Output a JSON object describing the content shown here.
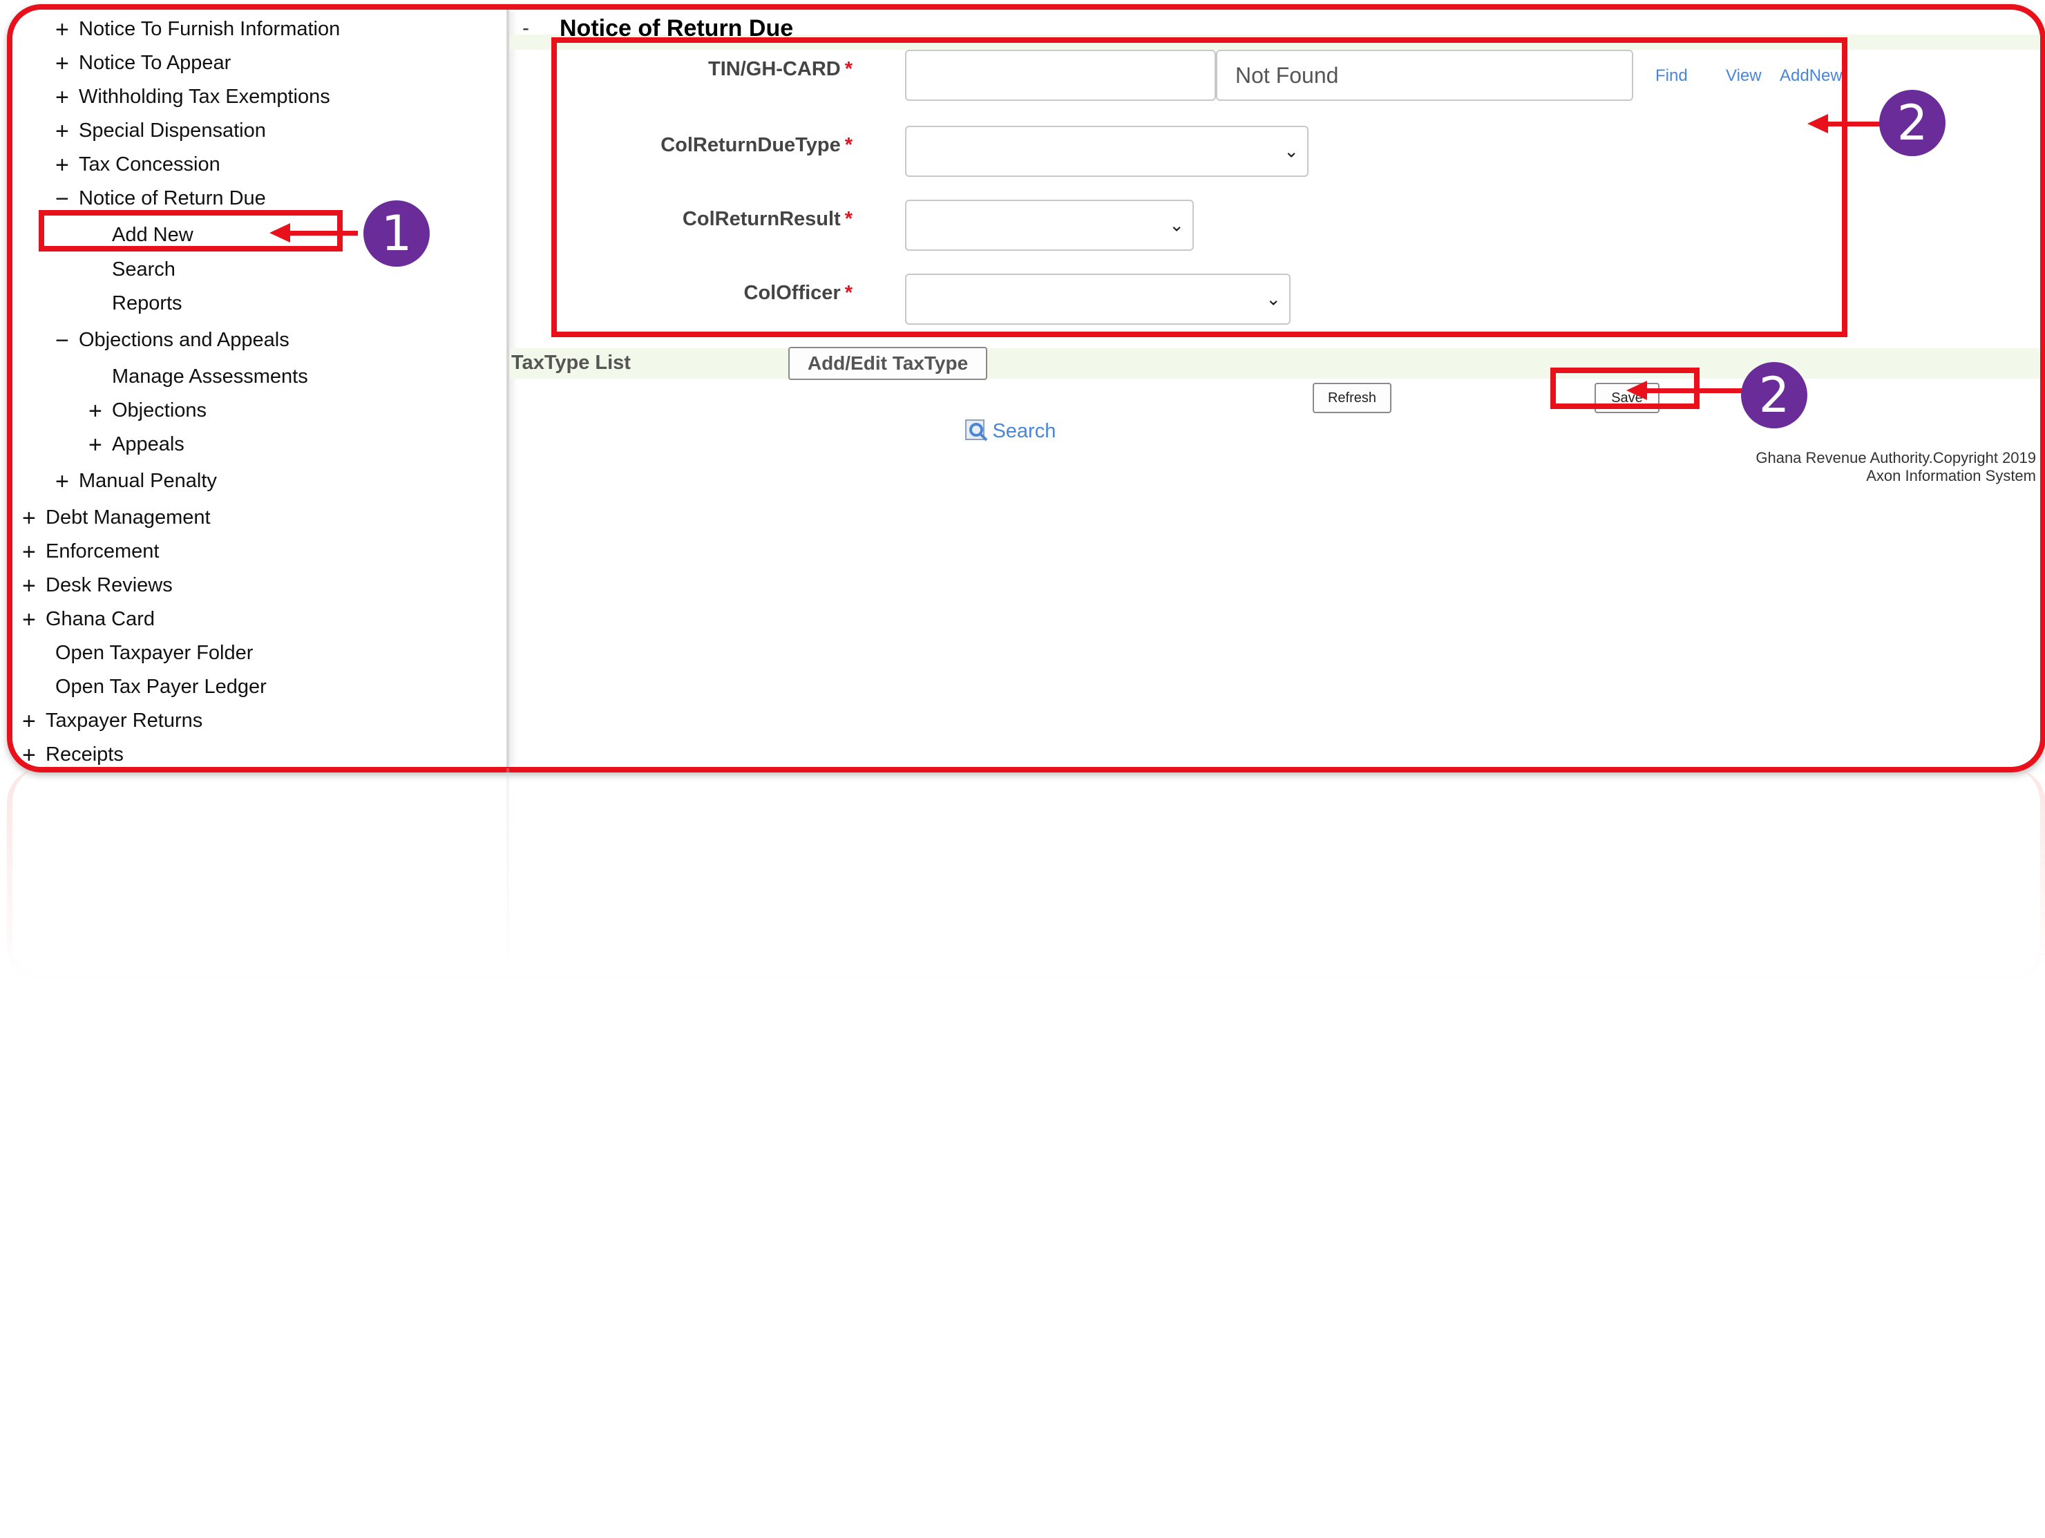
{
  "sidebar": {
    "items": [
      {
        "sign": "+",
        "label": "Notice To Furnish Information"
      },
      {
        "sign": "+",
        "label": "Notice To Appear"
      },
      {
        "sign": "+",
        "label": "Withholding Tax Exemptions"
      },
      {
        "sign": "+",
        "label": "Special Dispensation"
      },
      {
        "sign": "+",
        "label": "Tax Concession"
      },
      {
        "sign": "−",
        "label": "Notice of Return Due"
      },
      {
        "sign": "",
        "label": "Add New"
      },
      {
        "sign": "",
        "label": "Search"
      },
      {
        "sign": "",
        "label": "Reports"
      },
      {
        "sign": "−",
        "label": "Objections and Appeals"
      },
      {
        "sign": "",
        "label": "Manage Assessments"
      },
      {
        "sign": "+",
        "label": "Objections"
      },
      {
        "sign": "+",
        "label": "Appeals"
      },
      {
        "sign": "+",
        "label": "Manual Penalty"
      },
      {
        "sign": "+",
        "label": "Debt Management"
      },
      {
        "sign": "+",
        "label": "Enforcement"
      },
      {
        "sign": "+",
        "label": "Desk Reviews"
      },
      {
        "sign": "+",
        "label": "Ghana Card"
      },
      {
        "sign": "",
        "label": "Open Taxpayer Folder"
      },
      {
        "sign": "",
        "label": "Open Tax Payer Ledger"
      },
      {
        "sign": "+",
        "label": "Taxpayer Returns"
      },
      {
        "sign": "+",
        "label": "Receipts"
      }
    ]
  },
  "main": {
    "collapse": "-",
    "title": "Notice of Return Due",
    "fields": {
      "tin": {
        "label": "TIN/GH-CARD",
        "required": "*",
        "value": "",
        "lookup": "Not Found"
      },
      "return_due_type": {
        "label": "ColReturnDueType",
        "required": "*",
        "selected": ""
      },
      "return_result": {
        "label": "ColReturnResult",
        "required": "*",
        "selected": ""
      },
      "officer": {
        "label": "ColOfficer",
        "required": "*",
        "selected": ""
      }
    },
    "links": {
      "find": "Find",
      "view": "View",
      "add_new": "AddNew"
    },
    "taxtype_list_label": "TaxType List",
    "add_edit_taxtype": "Add/Edit  TaxType",
    "refresh": "Refresh",
    "save": "Save",
    "search": "Search",
    "footer_line1": "Ghana Revenue Authority.Copyright 2019",
    "footer_line2": "Axon Information System"
  },
  "annotations": {
    "badge1": "1",
    "badge2": "2",
    "badge3": "2"
  },
  "colors": {
    "highlight_red": "#e8101a",
    "badge_purple": "#6a2c98",
    "link_blue": "#4a86d8"
  },
  "icons": {
    "search": "search-icon",
    "chevron": "chevron-down-icon"
  }
}
